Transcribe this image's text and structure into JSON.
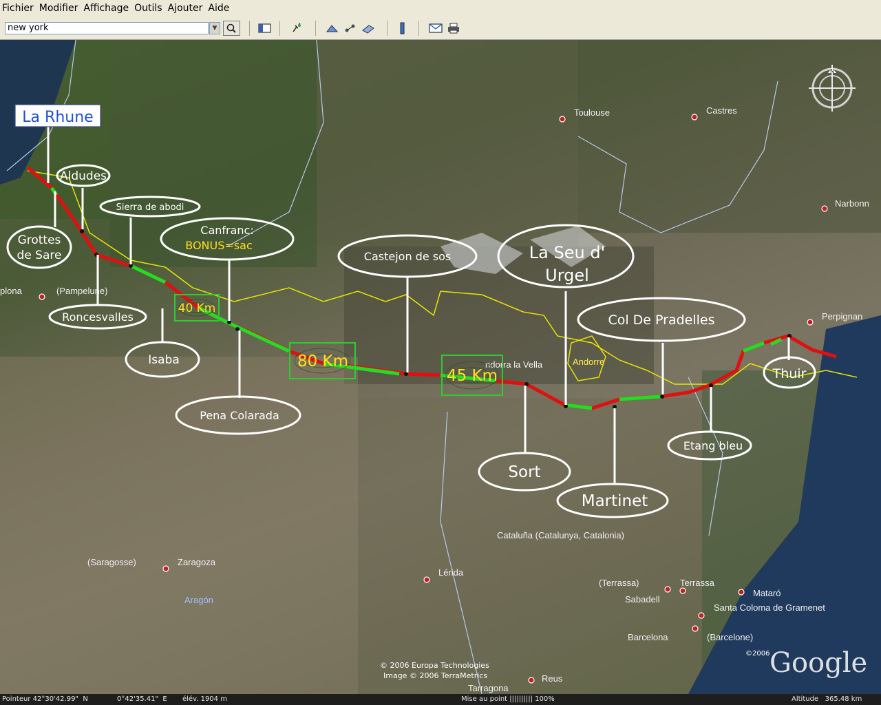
{
  "menu": [
    "Fichier",
    "Modifier",
    "Affichage",
    "Outils",
    "Ajouter",
    "Aide"
  ],
  "search": {
    "value": "new york"
  },
  "toolbar_icons": [
    "sidebar-icon",
    "placemark-icon",
    "polygon-icon",
    "path-icon",
    "overlay-icon",
    "ruler-icon",
    "email-icon",
    "print-icon"
  ],
  "map": {
    "cities": [
      "Toulouse",
      "Castres",
      "Narbonn",
      "Perpignan",
      "plona",
      "(Pampelune)",
      "ndorra la Vella",
      "Andorre",
      "Cataluña (Catalunya, Catalonia)",
      "(Saragosse)",
      "Zaragoza",
      "Aragón",
      "Lérida",
      "(Terrassa)",
      "Terrassa",
      "Sabadell",
      "Mataró",
      "Santa Coloma de Gramenet",
      "Barcelona",
      "(Barcelone)",
      "Reus",
      "Tarragona"
    ],
    "callouts": {
      "la_rhune": "La Rhune",
      "aldudes": "Aldudes",
      "sierra": "Sierra de abodi",
      "grottes_1": "Grottes",
      "grottes_2": "de Sare",
      "canfranc_1": "Canfranc:",
      "canfranc_2": "BONUS=sac",
      "roncesvalles": "Roncesvalles",
      "isaba": "Isaba",
      "pena": "Pena Colarada",
      "castejon": "Castejon de sos",
      "seu_1": "La Seu d'",
      "seu_2": "Urgel",
      "pradelles": "Col De Pradelles",
      "thuir": "Thuir",
      "etang": "Etang bleu",
      "sort": "Sort",
      "martinet": "Martinet"
    },
    "distances": [
      "40 Km",
      "80 Km",
      "45 Km"
    ],
    "copyright_1": "© 2006 Europa Technologies",
    "copyright_2": "Image © 2006 TerraMetrics",
    "google_year": "©2006",
    "google_logo": "Google",
    "colors": {
      "route_red": "#e01010",
      "route_green": "#22dd22",
      "border_yellow": "#e6e600",
      "box_green": "#2ecc2e"
    }
  },
  "status": {
    "pointer": "Pointeur 42°30'42.99\"  N",
    "lon": "0°42'35.41\"  E",
    "elev": "élév. 1904 m",
    "loading": "Mise au point |||||||||| 100%",
    "altitude": "Altitude   365.48 km"
  }
}
